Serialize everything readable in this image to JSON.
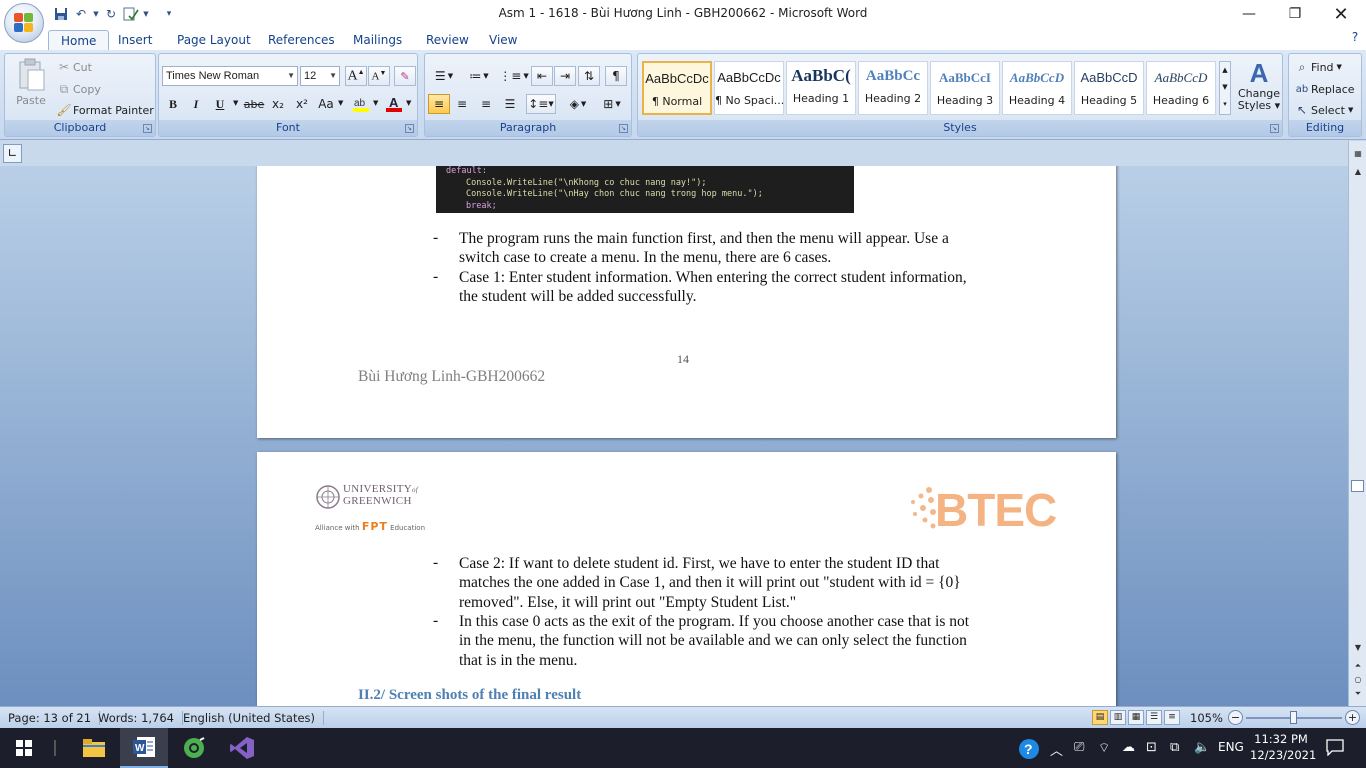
{
  "window": {
    "title": "Asm 1 - 1618 - Bùi Hương Linh - GBH200662 - Microsoft Word"
  },
  "tabs": [
    "Home",
    "Insert",
    "Page Layout",
    "References",
    "Mailings",
    "Review",
    "View"
  ],
  "ribbon": {
    "clipboard": {
      "label": "Clipboard",
      "paste": "Paste",
      "cut": "Cut",
      "copy": "Copy",
      "format_painter": "Format Painter"
    },
    "font": {
      "label": "Font",
      "font_name": "Times New Roman",
      "font_size": "12",
      "bold": "B",
      "italic": "I",
      "underline": "U",
      "strike": "abe",
      "subscript": "x₂",
      "superscript": "x²",
      "change_case": "Aa"
    },
    "paragraph": {
      "label": "Paragraph"
    },
    "styles": {
      "label": "Styles",
      "items": [
        {
          "sample": "AaBbCcDc",
          "name": "¶ Normal"
        },
        {
          "sample": "AaBbCcDc",
          "name": "¶ No Spaci..."
        },
        {
          "sample": "AaBbC(",
          "name": "Heading 1"
        },
        {
          "sample": "AaBbCc",
          "name": "Heading 2"
        },
        {
          "sample": "AaBbCcI",
          "name": "Heading 3"
        },
        {
          "sample": "AaBbCcD",
          "name": "Heading 4"
        },
        {
          "sample": "AaBbCcD",
          "name": "Heading 5"
        },
        {
          "sample": "AaBbCcD",
          "name": "Heading 6"
        }
      ],
      "change_styles_1": "Change",
      "change_styles_2": "Styles"
    },
    "editing": {
      "label": "Editing",
      "find": "Find",
      "replace": "Replace",
      "select": "Select"
    }
  },
  "document": {
    "page1": {
      "code_lines": [
        "default:",
        "Console.WriteLine(\"\\nKhong co chuc nang nay!\");",
        "Console.WriteLine(\"\\nHay chon chuc nang trong hop menu.\");",
        "break;"
      ],
      "bullets": [
        [
          "The program runs the main function first, and then the menu will appear. Use a",
          "switch case to create a menu. In the menu, there are 6 cases."
        ],
        [
          "Case 1: Enter student information. When entering the correct student information,",
          "the student will be added successfully."
        ]
      ],
      "page_number": "14",
      "footer": "Bùi Hương Linh-GBH200662"
    },
    "page2": {
      "logo_univ_1": "UNIVERSITY",
      "logo_univ_of": "of",
      "logo_univ_2": "GREENWICH",
      "logo_alliance": "Alliance with",
      "logo_fpt": "FPT",
      "logo_education": "Education",
      "logo_btec": "BTEC",
      "bullets": [
        [
          "Case 2: If want to delete student id. First, we have to enter the student ID that",
          "matches the one added in Case 1, and then it will print out \"student with id = {0}",
          "removed\". Else, it will print out \"Empty Student List.\""
        ],
        [
          "In this case 0 acts as the exit of the program. If you choose another case that is not",
          "in the menu, the function will not be available and we can only select the function",
          "that is in the menu."
        ]
      ],
      "heading": "II.2/ Screen shots of the final result"
    }
  },
  "statusbar": {
    "page": "Page: 13 of 21",
    "words": "Words: 1,764",
    "language": "English (United States)",
    "zoom": "105%"
  },
  "taskbar": {
    "language": "ENG",
    "time": "11:32 PM",
    "date": "12/23/2021"
  }
}
